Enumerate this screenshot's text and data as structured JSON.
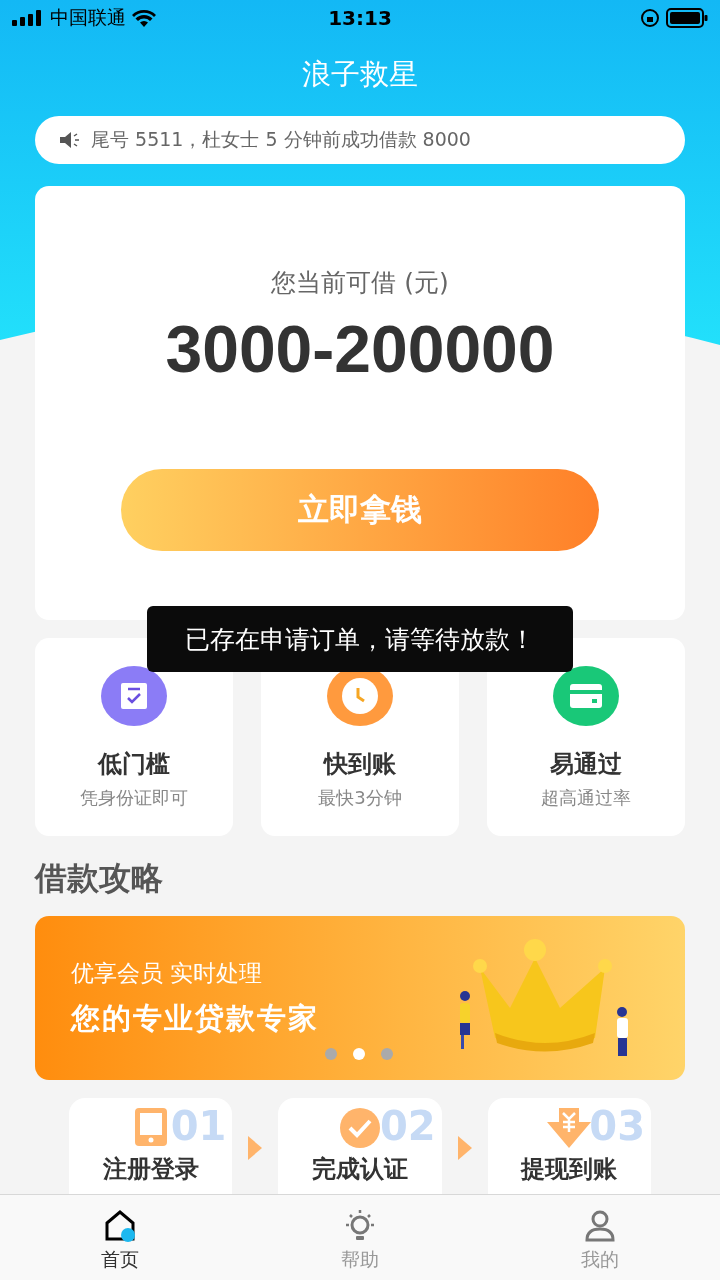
{
  "status_bar": {
    "carrier": "中国联通",
    "time": "13:13"
  },
  "title": "浪子救星",
  "notice": "尾号 5511，杜女士 5 分钟前成功借款 8000",
  "loan_card": {
    "label": "您当前可借 (元)",
    "amount": "3000-200000",
    "button": "立即拿钱"
  },
  "toast": "已存在申请订单，请等待放款！",
  "features": [
    {
      "kind": "form",
      "title": "低门槛",
      "subtitle": "凭身份证即可",
      "color": "#8b7cf6"
    },
    {
      "kind": "clock",
      "title": "快到账",
      "subtitle": "最快3分钟",
      "color": "#ff9a3e"
    },
    {
      "kind": "card",
      "title": "易通过",
      "subtitle": "超高通过率",
      "color": "#19c878"
    }
  ],
  "section_title": "借款攻略",
  "banner": {
    "line1": "优享会员 实时处理",
    "line2": "您的专业贷款专家",
    "dots": [
      {
        "selected": false
      },
      {
        "selected": true
      },
      {
        "selected": false
      }
    ]
  },
  "steps": [
    {
      "kind": "phone",
      "label": "注册登录",
      "number": "01"
    },
    {
      "kind": "check",
      "label": "完成认证",
      "number": "02"
    },
    {
      "kind": "yuan",
      "label": "提现到账",
      "number": "03"
    }
  ],
  "tabs": [
    {
      "kind": "home",
      "label": "首页",
      "selected": true
    },
    {
      "kind": "bulb",
      "label": "帮助",
      "selected": false
    },
    {
      "kind": "user",
      "label": "我的",
      "selected": false
    }
  ]
}
